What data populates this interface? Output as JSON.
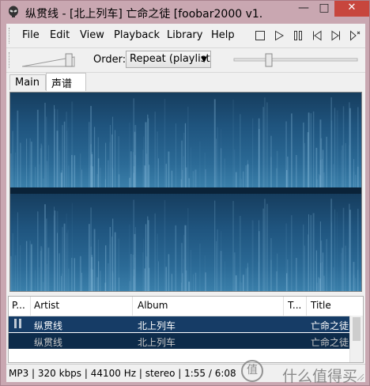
{
  "window": {
    "title": "纵贯线 - [北上列车] 亡命之徒   [foobar2000 v1.",
    "buttons": {
      "minimize": "—",
      "maximize": "□",
      "close": "✕"
    }
  },
  "menu": {
    "items": [
      "File",
      "Edit",
      "View",
      "Playback",
      "Library",
      "Help"
    ]
  },
  "playback_controls": [
    "stop-icon",
    "play-icon",
    "pause-icon",
    "previous-icon",
    "next-icon",
    "random-icon"
  ],
  "toolbar": {
    "order_label": "Order:",
    "order_value": "Repeat (playlist)",
    "volume_level": 0.95,
    "seek_level": 0.27
  },
  "tabs": [
    "Main",
    "声谱"
  ],
  "playlist": {
    "columns": [
      "P...",
      "Artist",
      "Album",
      "T...",
      "Title"
    ],
    "rows": [
      {
        "playing_icon": "pause-icon",
        "artist": "纵贯线",
        "album": "北上列车",
        "track": "",
        "title": "亡命之徒"
      },
      {
        "playing_icon": "",
        "artist": "纵贯线",
        "album": "北上列车",
        "track": "",
        "title": "亡命之徒"
      }
    ]
  },
  "status": {
    "text": "MP3 | 320 kbps | 44100 Hz | stereo | 1:55 / 6:08"
  },
  "watermark": {
    "logo": "值",
    "text": "什么值得买"
  },
  "colors": {
    "titlebar": "#c9a7b1",
    "close_button": "#c7463d",
    "spectrum_bg": "#08283f",
    "spectrum_band": "#2f6f99",
    "row_selected": "#163c66"
  }
}
